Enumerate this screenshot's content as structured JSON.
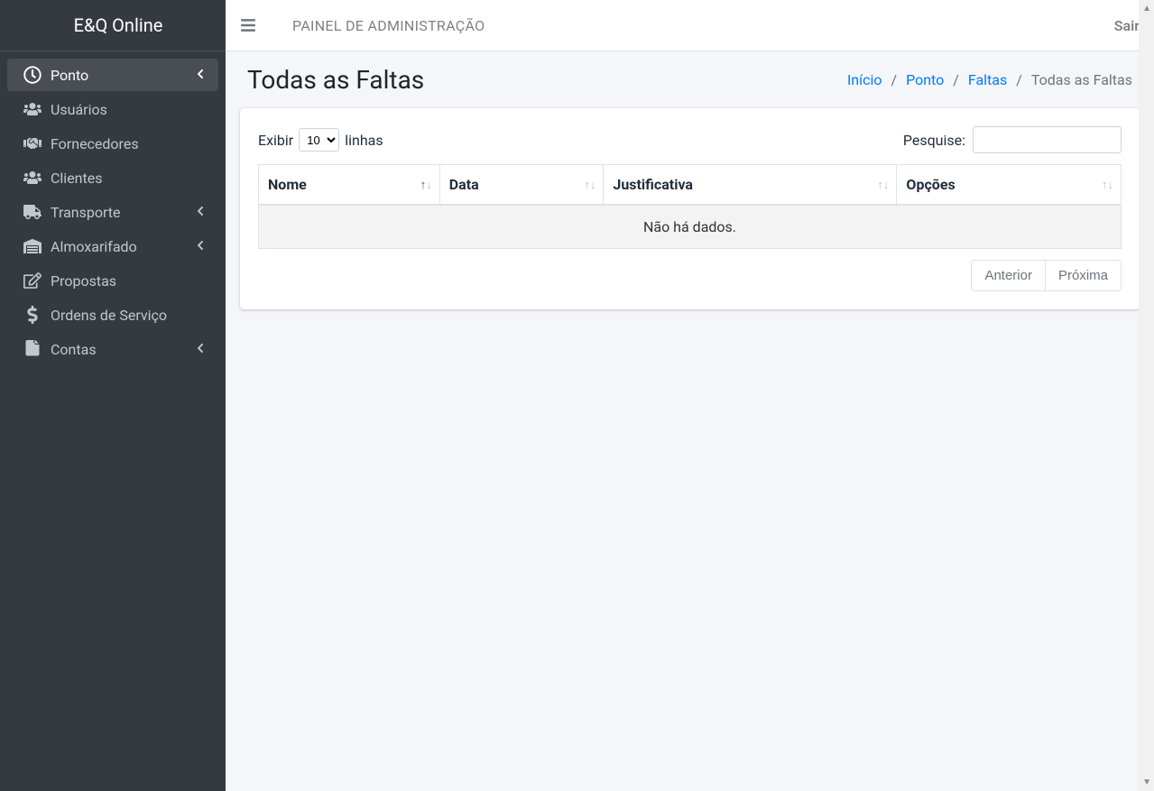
{
  "brand": "E&Q Online",
  "navbar": {
    "title": "PAINEL DE ADMINISTRAÇÃO",
    "logout": "Sair"
  },
  "sidebar": {
    "items": [
      {
        "label": "Ponto",
        "icon": "clock",
        "active": true,
        "caret": true
      },
      {
        "label": "Usuários",
        "icon": "users",
        "active": false,
        "caret": false
      },
      {
        "label": "Fornecedores",
        "icon": "handshake",
        "active": false,
        "caret": false
      },
      {
        "label": "Clientes",
        "icon": "users",
        "active": false,
        "caret": false
      },
      {
        "label": "Transporte",
        "icon": "truck",
        "active": false,
        "caret": true
      },
      {
        "label": "Almoxarifado",
        "icon": "warehouse",
        "active": false,
        "caret": true
      },
      {
        "label": "Propostas",
        "icon": "pen",
        "active": false,
        "caret": false
      },
      {
        "label": "Ordens de Serviço",
        "icon": "dollar",
        "active": false,
        "caret": false
      },
      {
        "label": "Contas",
        "icon": "invoice",
        "active": false,
        "caret": true
      }
    ]
  },
  "page": {
    "title": "Todas as Faltas",
    "breadcrumb": {
      "home": "Início",
      "lvl1": "Ponto",
      "lvl2": "Faltas",
      "current": "Todas as Faltas"
    }
  },
  "table": {
    "length_prefix": "Exibir",
    "length_value": "10",
    "length_suffix": "linhas",
    "search_label": "Pesquise:",
    "columns": {
      "nome": "Nome",
      "data": "Data",
      "justificativa": "Justificativa",
      "opcoes": "Opções"
    },
    "empty": "Não há dados.",
    "prev": "Anterior",
    "next": "Próxima"
  }
}
